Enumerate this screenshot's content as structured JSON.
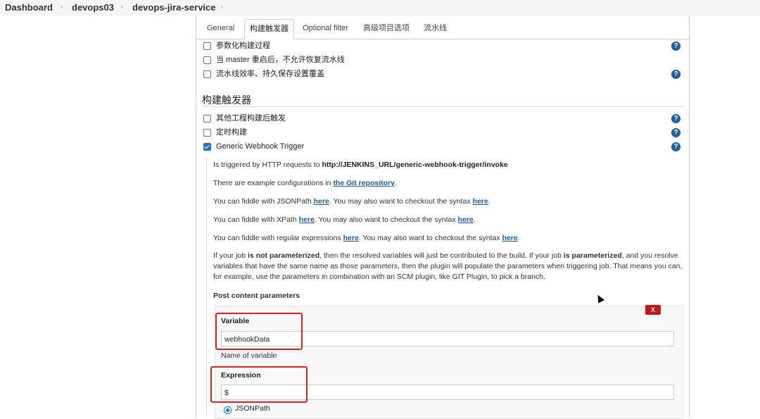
{
  "breadcrumb": {
    "items": [
      "Dashboard",
      "devops03",
      "devops-jira-service"
    ]
  },
  "tabs": [
    "General",
    "构建触发器",
    "Optional filter",
    "高级项目选项",
    "流水线"
  ],
  "general_options": [
    {
      "label": "参数化构建过程",
      "checked": false,
      "help": true
    },
    {
      "label": "当 master 重启后，不允许恢复流水线",
      "checked": false,
      "help": false
    },
    {
      "label": "流水线效率、持久保存设置覆盖",
      "checked": false,
      "help": true
    }
  ],
  "triggers": {
    "title": "构建触发器",
    "options": [
      {
        "label": "其他工程构建后触发",
        "checked": false
      },
      {
        "label": "定时构建",
        "checked": false
      },
      {
        "label": "Generic Webhook Trigger",
        "checked": true
      }
    ]
  },
  "help_glyph": "?",
  "webhook": {
    "line1_prefix": "Is triggered by HTTP requests to ",
    "line1_url": "http://JENKINS_URL/generic-webhook-trigger/invoke",
    "line2_prefix": "There are example configurations in ",
    "line2_link": "the Git repository",
    "line2_suffix": ".",
    "line3_a": "You can fiddle with JSONPath ",
    "line3_link1": "here",
    "line3_b": ". You may also want to checkout the syntax ",
    "line3_link2": "here",
    "line3_c": ".",
    "line4_a": "You can fiddle with XPath ",
    "line4_link1": "here",
    "line4_b": ". You may also want to checkout the syntax ",
    "line4_link2": "here",
    "line4_c": ".",
    "line5_a": "You can fiddle with regular expressions ",
    "line5_link1": "here",
    "line5_b": ". You may also want to checkout the syntax ",
    "line5_link2": "here",
    "line5_c": ".",
    "para_a": "If your job ",
    "para_b1": "is not parameterized",
    "para_c": ", then the resolved variables will just be contributed to the build. If your job ",
    "para_b2": "is parameterized",
    "para_d": ", and you resolve variables that have the same name as those parameters, then the plugin will populate the parameters when triggering job. That means you can, for example, use the parameters in combination with an SCM plugin, like GIT Plugin, to pick a branch."
  },
  "post_params": {
    "title": "Post content parameters",
    "delete_label": "X",
    "variable_label": "Variable",
    "variable_value": "webhookData",
    "variable_help": "Name of variable",
    "expression_label": "Expression",
    "expression_value": "$",
    "expression_type": "JSONPath"
  },
  "colors": {
    "accent": "#1b73d6",
    "link": "#1a5c9e",
    "help_icon": "#1e5ea6",
    "highlight": "#e02020",
    "delete": "#c4161c"
  }
}
